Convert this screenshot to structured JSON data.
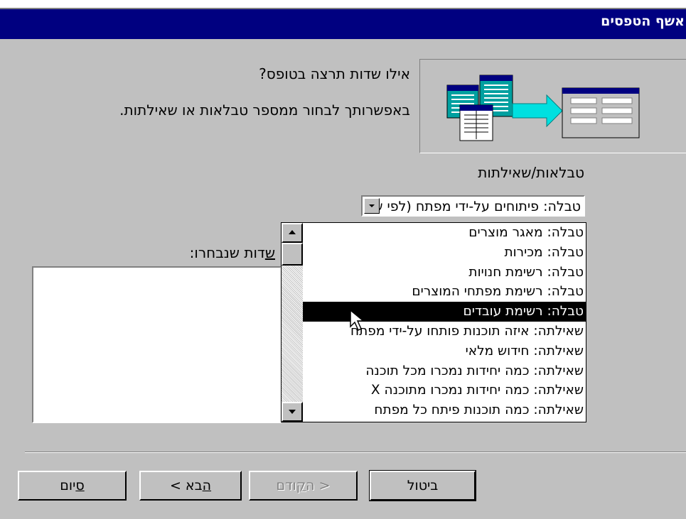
{
  "window": {
    "title": "אשף הטפסים"
  },
  "intro": {
    "question": "אילו שדות תרצה בטופס?",
    "hint": "באפשרותך לבחור ממספר טבלאות או שאילתות."
  },
  "tables_queries": {
    "label": "טבלאות/שאילתות",
    "selected_value": "טבלה: פיתוחים על-ידי מפתח (לפי שם",
    "options": [
      "טבלה: מאגר מוצרים",
      "טבלה: מכירות",
      "טבלה: רשימת חנויות",
      "טבלה: רשימת מפתחי המוצרים",
      "טבלה: רשימת עובדים",
      "שאילתה: איזה תוכנות פותחו על-ידי מפתח",
      "שאילתה: חידוש מלאי",
      "שאילתה: כמה יחידות נמכרו מכל תוכנה",
      "שאילתה: כמה יחידות נמכרו מתוכנה X",
      "שאילתה: כמה תוכנות פיתח כל מפתח"
    ],
    "highlighted_index": 4
  },
  "selected_fields": {
    "label": "שדות שנבחרו:"
  },
  "buttons": {
    "finish": "סיום",
    "next": "הבא >",
    "back": "< הקודם",
    "cancel": "ביטול"
  },
  "colors": {
    "titlebar": "#000080",
    "highlight": "#000000",
    "face": "#c0c0c0"
  }
}
